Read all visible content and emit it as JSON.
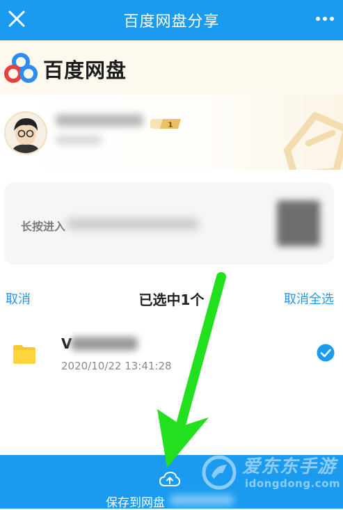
{
  "header": {
    "title": "百度网盘分享",
    "close_icon": "close-icon",
    "more_icon": "more-dots-icon",
    "bg_color": "#1a9bf0"
  },
  "brand": {
    "name": "百度网盘",
    "logo_icon": "baidu-netdisk-logo"
  },
  "sharer": {
    "vip_level": "1"
  },
  "qr_card": {
    "hint_text": "长按进入"
  },
  "selection": {
    "cancel_label": "取消",
    "selected_count_label": "已选中1个",
    "cancel_all_label": "取消全选"
  },
  "files": [
    {
      "name_visible": "V",
      "date": "2020/10/22 13:41:28",
      "icon": "folder-icon",
      "checked": true
    }
  ],
  "bottom_bar": {
    "save_label": "保存到网盘",
    "icon": "cloud-upload-icon"
  },
  "watermark": {
    "cn": "爱东东手游",
    "en": "idongdong.com"
  },
  "colors": {
    "accent": "#1a9bf0",
    "arrow": "#22e01e",
    "folder": "#f9c72d"
  }
}
